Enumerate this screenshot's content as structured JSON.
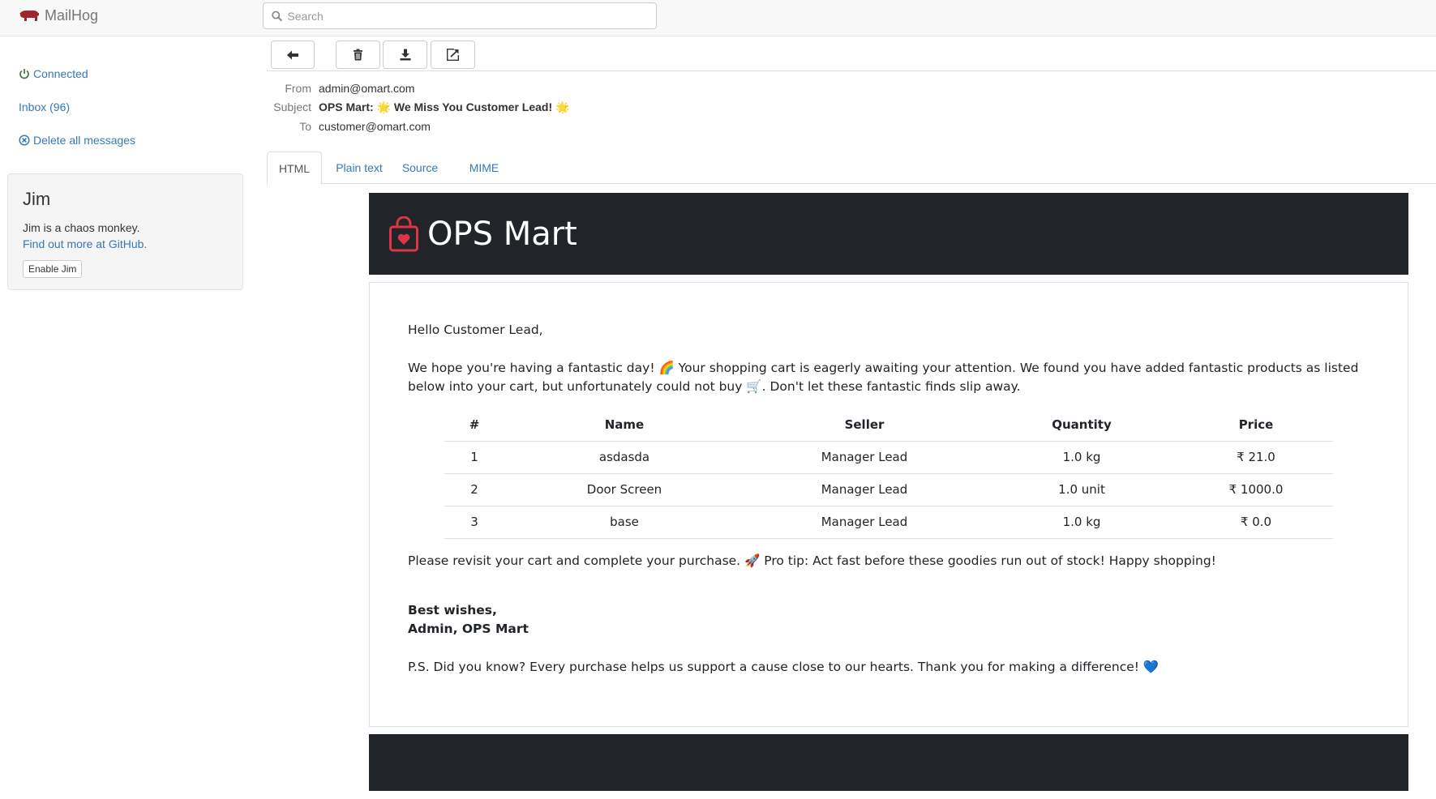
{
  "app": {
    "title": "MailHog"
  },
  "search": {
    "placeholder": "Search"
  },
  "sidebar": {
    "connected": "Connected",
    "inbox": "Inbox (96)",
    "delete_all": "Delete all messages"
  },
  "jim": {
    "title": "Jim",
    "description": "Jim is a chaos monkey.",
    "link": "Find out more at GitHub.",
    "button": "Enable Jim"
  },
  "message": {
    "from_label": "From",
    "from": "admin@omart.com",
    "subject_label": "Subject",
    "subject": "OPS Mart: 🌟 We Miss You Customer Lead! 🌟",
    "to_label": "To",
    "to": "customer@omart.com"
  },
  "tabs": [
    "HTML",
    "Plain text",
    "Source",
    "MIME"
  ],
  "email": {
    "brand": "OPS Mart",
    "greeting": "Hello Customer Lead,",
    "intro": "We hope you're having a fantastic day! 🌈 Your shopping cart is eagerly awaiting your attention. We found you have added fantastic products as listed below into your cart, but unfortunately could not buy 🛒. Don't let these fantastic finds slip away.",
    "table": {
      "headers": [
        "#",
        "Name",
        "Seller",
        "Quantity",
        "Price"
      ],
      "rows": [
        [
          "1",
          "asdasda",
          "Manager Lead",
          "1.0 kg",
          "₹ 21.0"
        ],
        [
          "2",
          "Door Screen",
          "Manager Lead",
          "1.0 unit",
          "₹ 1000.0"
        ],
        [
          "3",
          "base",
          "Manager Lead",
          "1.0 kg",
          "₹ 0.0"
        ]
      ]
    },
    "revisit": "Please revisit your cart and complete your purchase. 🚀 Pro tip: Act fast before these goodies run out of stock! Happy shopping!",
    "sign_1": "Best wishes,",
    "sign_2": "Admin, OPS Mart",
    "ps": "P.S. Did you know? Every purchase helps us support a cause close to our hearts. Thank you for making a difference! 💙"
  },
  "colors": {
    "link": "#337ab7",
    "connected": "#3c763d",
    "email_dark": "#212529",
    "brand_red": "#dc3545"
  }
}
